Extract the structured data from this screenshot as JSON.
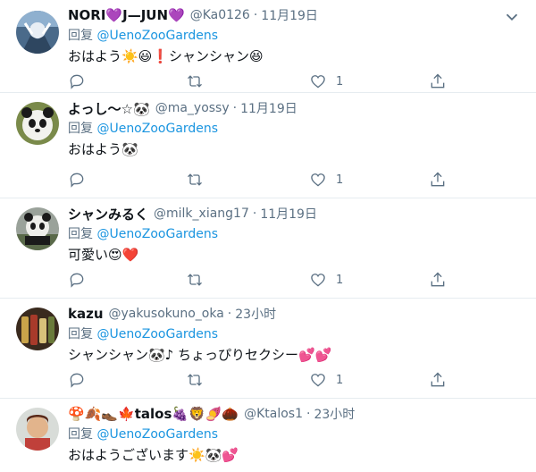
{
  "colors": {
    "accent": "#1b95e0",
    "muted": "#5b7083",
    "text": "#0f1419",
    "heart": "#e0245e",
    "divider": "#e6ecf0"
  },
  "tweets": [
    {
      "display_name": "NORI💜J—JUN💜",
      "handle": "@Ka0126",
      "separator": "·",
      "time": "11月19日",
      "reply_prefix": "回复",
      "reply_to": "@UenoZooGardens",
      "text": "おはよう☀️😃❗シャンシャン😆",
      "like_count": "1",
      "icons": [
        "reply-icon",
        "retweet-icon",
        "like-icon",
        "share-icon"
      ]
    },
    {
      "display_name": "よっし～☆🐼",
      "handle": "@ma_yossy",
      "separator": "·",
      "time": "11月19日",
      "reply_prefix": "回复",
      "reply_to": "@UenoZooGardens",
      "text": "おはよう🐼",
      "like_count": "1",
      "icons": [
        "reply-icon",
        "retweet-icon",
        "like-icon",
        "share-icon"
      ]
    },
    {
      "display_name": "シャンみるく",
      "handle": "@milk_xiang17",
      "separator": "·",
      "time": "11月19日",
      "reply_prefix": "回复",
      "reply_to": "@UenoZooGardens",
      "text": "可愛い😍❤️",
      "like_count": "1",
      "icons": [
        "reply-icon",
        "retweet-icon",
        "like-icon",
        "share-icon"
      ]
    },
    {
      "display_name": "kazu",
      "handle": "@yakusokuno_oka",
      "separator": "·",
      "time": "23小时",
      "reply_prefix": "回复",
      "reply_to": "@UenoZooGardens",
      "text": "シャンシャン🐼♪ ちょっぴりセクシー💕💕",
      "like_count": "1",
      "icons": [
        "reply-icon",
        "retweet-icon",
        "like-icon",
        "share-icon"
      ]
    },
    {
      "display_name": "🍄🍂👞🍁talos🍇🦁🍠🌰",
      "handle": "@Ktalos1",
      "separator": "·",
      "time": "23小时",
      "reply_prefix": "回复",
      "reply_to": "@UenoZooGardens",
      "text": "おはようございます☀️🐼💕",
      "like_count": "",
      "icons": []
    }
  ]
}
